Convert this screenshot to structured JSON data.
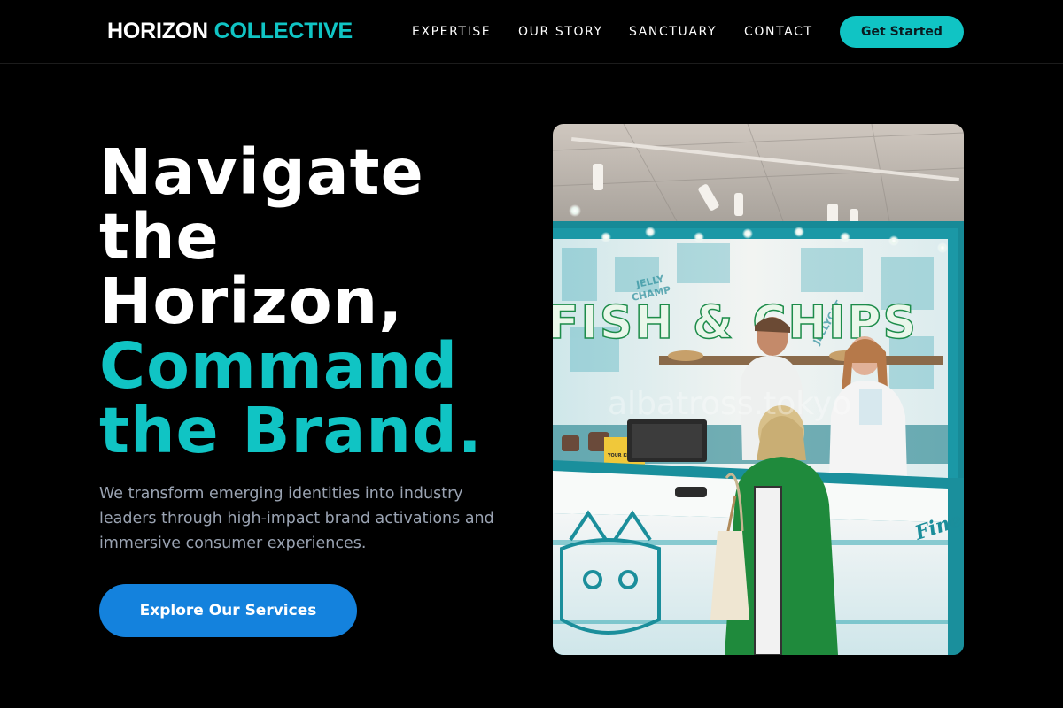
{
  "nav": {
    "logo_primary": "HORIZON",
    "logo_accent": "COLLECTIVE",
    "links": [
      "EXPERTISE",
      "OUR STORY",
      "SANCTUARY",
      "CONTACT"
    ],
    "cta_label": "Get Started"
  },
  "hero": {
    "headline_lines": [
      "Navigate",
      "the",
      "Horizon,"
    ],
    "headline_accent_lines": [
      "Command",
      "the Brand."
    ],
    "description": "We transform emerging identities into industry leaders through high-impact brand activations and immersive consumer experiences.",
    "button_label": "Explore Our Services",
    "image": {
      "sign_text": "FISH & CHIPS",
      "watermark": "albatross.tokyo",
      "counter_script": "Finest",
      "card_text": "YOUR KEY TO EXTRAORDINARY"
    }
  },
  "colors": {
    "accent": "#10c4c4",
    "button_blue": "#1482dd",
    "background": "#000000",
    "muted_text": "#9aa3b2"
  }
}
